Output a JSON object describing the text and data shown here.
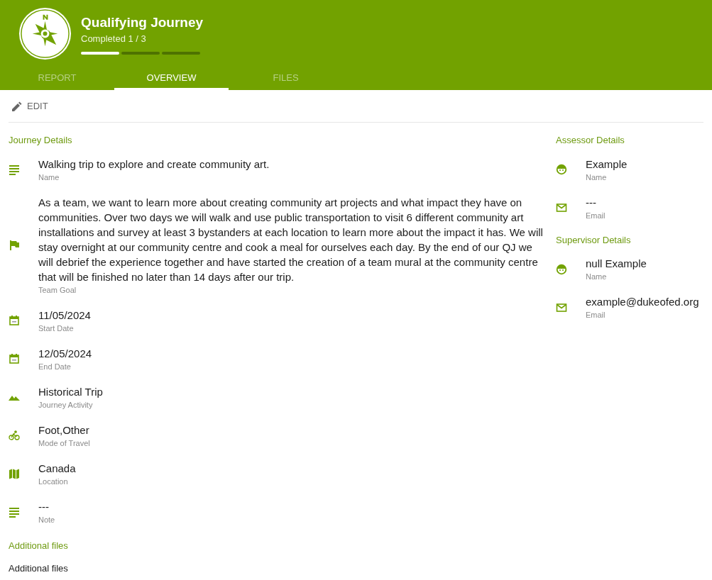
{
  "header": {
    "title": "Qualifying Journey",
    "subtitle": "Completed 1 / 3",
    "steps": [
      {
        "done": true
      },
      {
        "done": false
      },
      {
        "done": false
      }
    ]
  },
  "tabs": [
    {
      "label": "REPORT",
      "selected": false
    },
    {
      "label": "OVERVIEW",
      "selected": true
    },
    {
      "label": "FILES",
      "selected": false
    }
  ],
  "toolbar": {
    "edit_label": "EDIT"
  },
  "journey_details": {
    "heading": "Journey Details",
    "fields": [
      {
        "kind": "lines",
        "value": "Walking trip to explore and create community art.",
        "label": "Name"
      },
      {
        "kind": "flag",
        "value": "As a team, we want to learn more about creating community art projects and what impact they have on communities. Over two days we will walk and use public transportation to visit 6 different community art installations and survey at least 3 bystanders at each location to learn more about the impact it has. We will stay overnight at our community centre and cook a meal for ourselves each day. By the end of our QJ we will debrief the experience together and have started the creation of a team mural at the community centre that will be finished no later than 14 days after our trip.",
        "label": "Team Goal"
      },
      {
        "kind": "calendar",
        "value": "11/05/2024",
        "label": "Start Date"
      },
      {
        "kind": "calendar",
        "value": "12/05/2024",
        "label": "End Date"
      },
      {
        "kind": "mountain",
        "value": "Historical Trip",
        "label": "Journey Activity"
      },
      {
        "kind": "bike",
        "value": "Foot,Other",
        "label": "Mode of Travel"
      },
      {
        "kind": "map",
        "value": "Canada",
        "label": "Location"
      },
      {
        "kind": "lines",
        "value": "---",
        "label": "Note"
      }
    ]
  },
  "additional_files": {
    "heading": "Additional files",
    "text": "Additional files"
  },
  "assessor_details": {
    "heading": "Assessor Details",
    "fields": [
      {
        "kind": "face",
        "value": "Example",
        "label": "Name"
      },
      {
        "kind": "mail",
        "value": "---",
        "label": "Email"
      }
    ]
  },
  "supervisor_details": {
    "heading": "Supervisor Details",
    "fields": [
      {
        "kind": "face",
        "value": "null Example",
        "label": "Name"
      },
      {
        "kind": "mail",
        "value": "example@dukeofed.org",
        "label": "Email"
      }
    ]
  }
}
